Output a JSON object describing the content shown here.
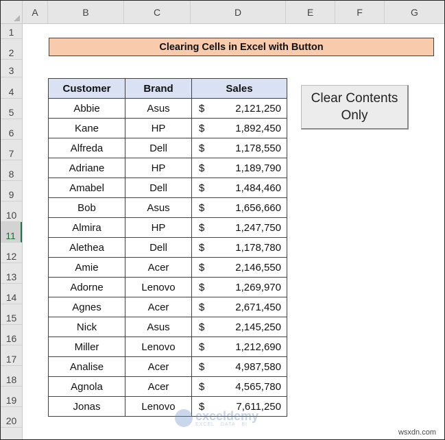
{
  "columns": [
    "A",
    "B",
    "C",
    "D",
    "E",
    "F",
    "G"
  ],
  "rows": [
    "1",
    "2",
    "3",
    "4",
    "5",
    "6",
    "7",
    "8",
    "9",
    "10",
    "11",
    "12",
    "13",
    "14",
    "15",
    "16",
    "17",
    "18",
    "19",
    "20"
  ],
  "title": "Clearing Cells in Excel with Button",
  "table": {
    "headers": {
      "customer": "Customer",
      "brand": "Brand",
      "sales": "Sales"
    },
    "currency": "$",
    "rows": [
      {
        "customer": "Abbie",
        "brand": "Asus",
        "sales": "2,121,250"
      },
      {
        "customer": "Kane",
        "brand": "HP",
        "sales": "1,892,450"
      },
      {
        "customer": "Alfreda",
        "brand": "Dell",
        "sales": "1,178,550"
      },
      {
        "customer": "Adriane",
        "brand": "HP",
        "sales": "1,189,790"
      },
      {
        "customer": "Amabel",
        "brand": "Dell",
        "sales": "1,484,460"
      },
      {
        "customer": "Bob",
        "brand": "Asus",
        "sales": "1,656,660"
      },
      {
        "customer": "Almira",
        "brand": "HP",
        "sales": "1,247,750"
      },
      {
        "customer": "Alethea",
        "brand": "Dell",
        "sales": "1,178,780"
      },
      {
        "customer": "Amie",
        "brand": "Acer",
        "sales": "2,146,550"
      },
      {
        "customer": "Adorne",
        "brand": "Lenovo",
        "sales": "1,269,970"
      },
      {
        "customer": "Agnes",
        "brand": "Acer",
        "sales": "2,671,450"
      },
      {
        "customer": "Nick",
        "brand": "Asus",
        "sales": "2,145,250"
      },
      {
        "customer": "Miller",
        "brand": "Lenovo",
        "sales": "1,212,690"
      },
      {
        "customer": "Analise",
        "brand": "Acer",
        "sales": "4,987,580"
      },
      {
        "customer": "Agnola",
        "brand": "Acer",
        "sales": "4,565,780"
      },
      {
        "customer": "Jonas",
        "brand": "Lenovo",
        "sales": "7,611,250"
      }
    ]
  },
  "button": {
    "line1": "Clear Contents",
    "line2": "Only"
  },
  "active_row": "11",
  "watermark": {
    "main": "exceldemy",
    "sub": "EXCEL · DATA · BI"
  },
  "site": "wsxdn.com",
  "colors": {
    "title_fill": "#f8cbad",
    "header_fill": "#d9e1f2",
    "active_row_accent": "#1e7145"
  }
}
